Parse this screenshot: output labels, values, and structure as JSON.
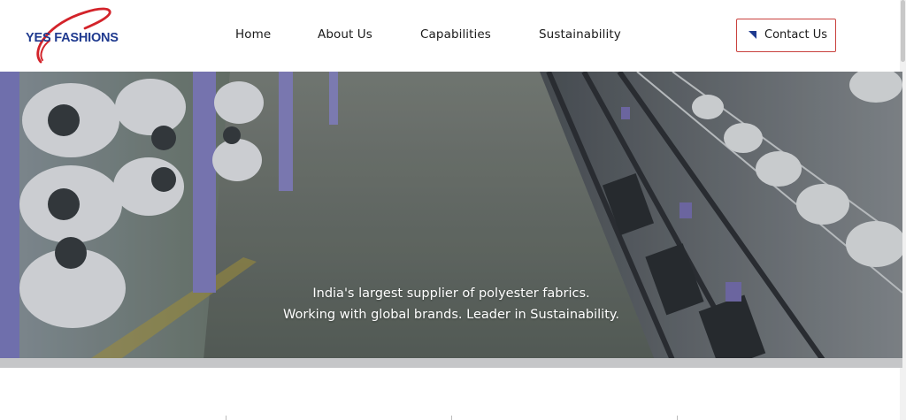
{
  "brand": {
    "logo_text": "YES FASHIONS",
    "primary_color": "#1f3a8f",
    "accent_color": "#d3232a"
  },
  "nav": {
    "items": [
      {
        "label": "Home"
      },
      {
        "label": "About Us"
      },
      {
        "label": "Capabilities"
      },
      {
        "label": "Sustainability"
      }
    ],
    "contact_label": "Contact Us",
    "contact_icon": "triangle-marker-icon"
  },
  "hero": {
    "line1": "India's largest supplier of polyester fabrics.",
    "line2": "Working with global brands. Leader in Sustainability."
  }
}
